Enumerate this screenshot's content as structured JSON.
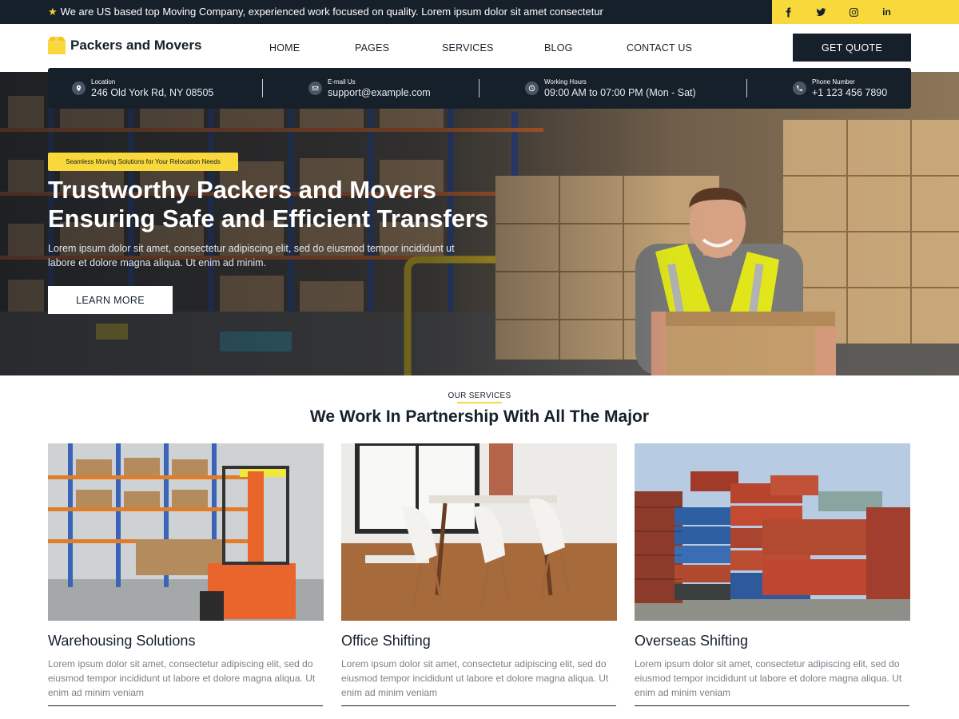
{
  "topbar": {
    "message": "We are US based top Moving Company, experienced work focused on quality. Lorem ipsum dolor sit amet consectetur",
    "social": [
      {
        "icon": "facebook-icon"
      },
      {
        "icon": "twitter-icon"
      },
      {
        "icon": "instagram-icon"
      },
      {
        "icon": "linkedin-icon",
        "text": "in"
      }
    ]
  },
  "header": {
    "logo_text": "Packers and Movers",
    "nav": [
      "HOME",
      "PAGES",
      "SERVICES",
      "BLOG",
      "CONTACT US"
    ],
    "quote_button": "GET QUOTE"
  },
  "infobar": [
    {
      "icon": "location-pin-icon",
      "label": "Location",
      "value": "246 Old York Rd, NY 08505"
    },
    {
      "icon": "email-icon",
      "label": "E-mail Us",
      "value": "support@example.com"
    },
    {
      "icon": "clock-icon",
      "label": "Working Hours",
      "value": "09:00 AM to 07:00 PM (Mon - Sat)"
    },
    {
      "icon": "phone-icon",
      "label": "Phone Number",
      "value": "+1 123 456 7890"
    }
  ],
  "hero": {
    "badge": "Seamless Moving Solutions for Your Relocation Needs",
    "title_line1": "Trustworthy Packers and Movers",
    "title_line2": "Ensuring Safe and Efficient Transfers",
    "description": "Lorem ipsum dolor sit amet, consectetur adipiscing elit, sed do eiusmod tempor incididunt ut labore et dolore magna aliqua. Ut enim ad minim.",
    "button": "LEARN MORE"
  },
  "services": {
    "kicker": "OUR SERVICES",
    "title": "We Work In Partnership With All The Major",
    "cards": [
      {
        "title": "Warehousing Solutions",
        "description": "Lorem ipsum dolor sit amet, consectetur adipiscing elit, sed do eiusmod tempor incididunt ut labore et dolore magna aliqua. Ut enim ad minim veniam"
      },
      {
        "title": "Office Shifting",
        "description": "Lorem ipsum dolor sit amet, consectetur adipiscing elit, sed do eiusmod tempor incididunt ut labore et dolore magna aliqua. Ut enim ad minim veniam"
      },
      {
        "title": "Overseas Shifting",
        "description": "Lorem ipsum dolor sit amet, consectetur adipiscing elit, sed do eiusmod tempor incididunt ut labore et dolore magna aliqua. Ut enim ad minim veniam"
      }
    ]
  },
  "colors": {
    "dark": "#16202b",
    "accent": "#f8d83a",
    "muted_text": "#7b8189"
  }
}
